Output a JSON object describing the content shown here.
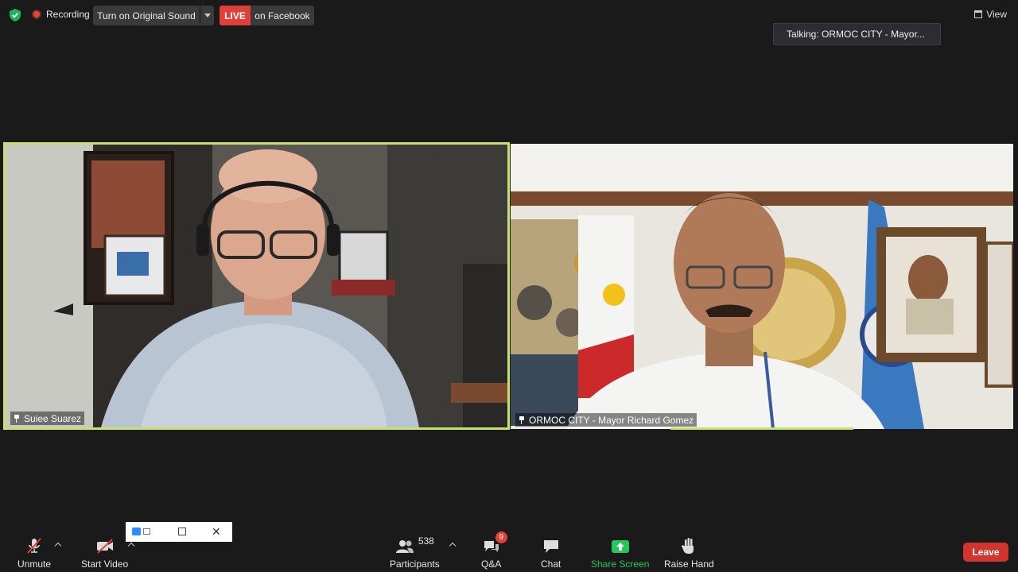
{
  "top_bar": {
    "recording_label": "Recording",
    "original_sound_button": "Turn on Original Sound",
    "live_badge": "LIVE",
    "live_destination": "on Facebook",
    "view_button": "View",
    "talking_indicator": "Talking: ORMOC CITY - Mayor..."
  },
  "participants_tiles": [
    {
      "name": "Suiee Suarez",
      "active_speaker_frame": true
    },
    {
      "name": "ORMOC CITY - Mayor Richard Gomez",
      "active_speaker_frame": false
    }
  ],
  "toolbar": {
    "unmute_label": "Unmute",
    "start_video_label": "Start Video",
    "participants_label": "Participants",
    "participants_count": "538",
    "qa_label": "Q&A",
    "qa_badge": "9",
    "chat_label": "Chat",
    "share_screen_label": "Share Screen",
    "raise_hand_label": "Raise Hand",
    "leave_label": "Leave"
  },
  "colors": {
    "background": "#1a1a1a",
    "active_speaker": "#c9e06b",
    "live_red": "#e0403a",
    "share_green": "#25c75a",
    "leave_red": "#d1352d"
  }
}
